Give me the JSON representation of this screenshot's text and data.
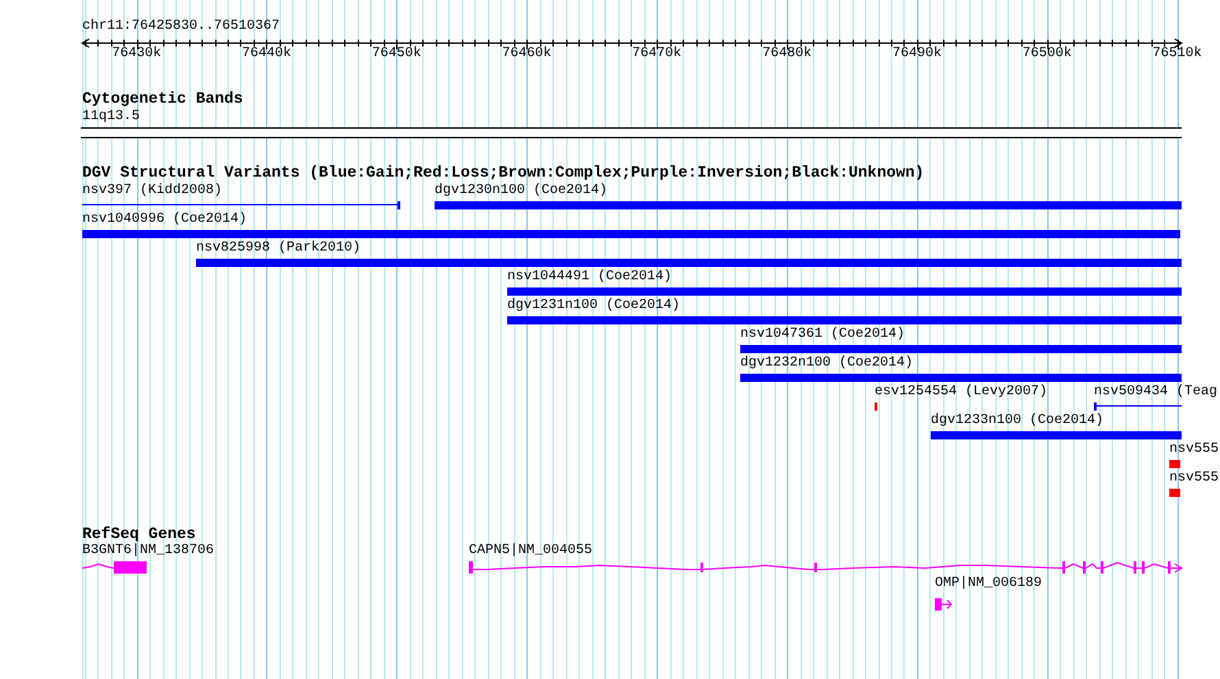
{
  "ruler": {
    "location": "chr11:76425830..76510367",
    "ticks": [
      "76430k",
      "76440k",
      "76450k",
      "76460k",
      "76470k",
      "76480k",
      "76490k",
      "76500k",
      "76510k"
    ]
  },
  "cytogenetic_bands": {
    "title": "Cytogenetic Bands",
    "band": "11q13.5"
  },
  "structural_variants": {
    "title": "DGV Structural Variants (Blue:Gain;Red:Loss;Brown:Complex;Purple:Inversion;Black:Unknown)",
    "features": [
      {
        "label": "nsv397 (Kidd2008)",
        "kind": "line",
        "color": "#0000ff"
      },
      {
        "label": "dgv1230n100 (Coe2014)",
        "kind": "bar",
        "color": "#0000ff"
      },
      {
        "label": "nsv1040996 (Coe2014)",
        "kind": "bar",
        "color": "#0000ff"
      },
      {
        "label": "nsv825998 (Park2010)",
        "kind": "bar",
        "color": "#0000ff"
      },
      {
        "label": "nsv1044491 (Coe2014)",
        "kind": "bar",
        "color": "#0000ff"
      },
      {
        "label": "dgv1231n100 (Coe2014)",
        "kind": "bar",
        "color": "#0000ff"
      },
      {
        "label": "nsv1047361 (Coe2014)",
        "kind": "bar",
        "color": "#0000ff"
      },
      {
        "label": "dgv1232n100 (Coe2014)",
        "kind": "bar",
        "color": "#0000ff"
      },
      {
        "label": "esv1254554 (Levy2007)",
        "kind": "bar",
        "color": "#ff0000"
      },
      {
        "label": "nsv509434 (Teag",
        "kind": "line",
        "color": "#0000ff"
      },
      {
        "label": "dgv1233n100 (Coe2014)",
        "kind": "bar",
        "color": "#0000ff"
      },
      {
        "label": "nsv555",
        "kind": "bar",
        "color": "#ff0000"
      },
      {
        "label": "nsv555",
        "kind": "bar",
        "color": "#ff0000"
      }
    ]
  },
  "refseq_genes": {
    "title": "RefSeq Genes",
    "genes": [
      {
        "label": "B3GNT6|NM_138706"
      },
      {
        "label": "CAPN5|NM_004055"
      },
      {
        "label": "OMP|NM_006189"
      }
    ]
  }
}
